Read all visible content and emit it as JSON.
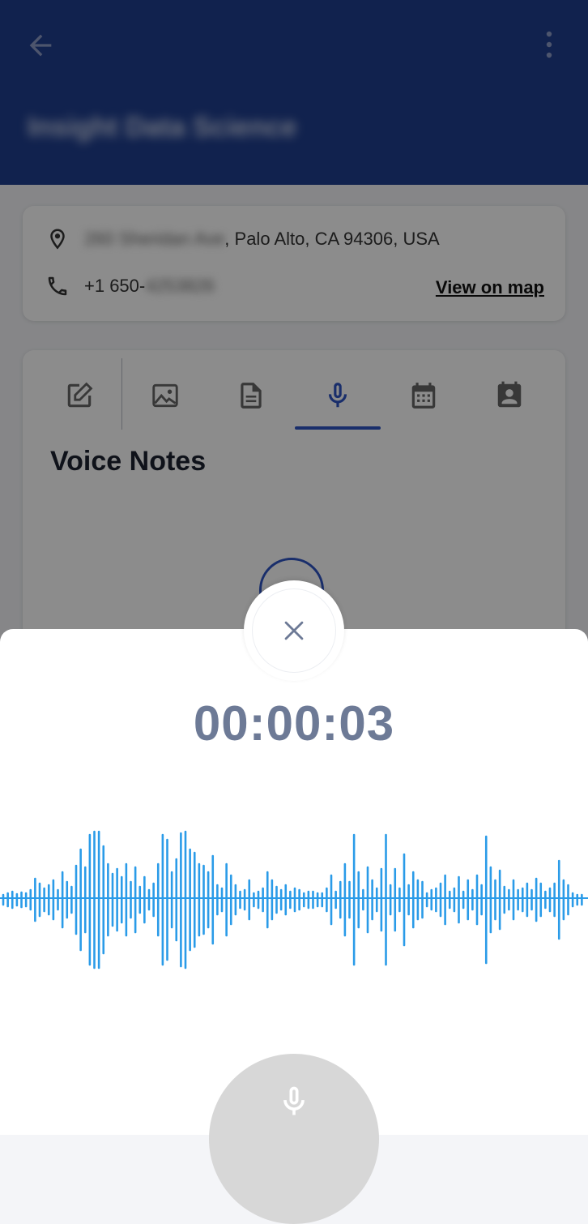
{
  "header": {
    "title": "Insight Data Science",
    "back_icon": "arrow-back-icon",
    "menu_icon": "more-vert-icon",
    "color": "#1f3e8e"
  },
  "info": {
    "address_prefix": "260 Sheridan Ave",
    "address_suffix": ", Palo Alto, CA 94306, USA",
    "phone_prefix": "+1 650-",
    "phone_hidden": "4253826",
    "view_on_map": "View on map"
  },
  "tabs": [
    {
      "icon": "edit-note-icon",
      "active": false
    },
    {
      "icon": "image-icon",
      "active": false
    },
    {
      "icon": "document-icon",
      "active": false
    },
    {
      "icon": "microphone-icon",
      "active": true
    },
    {
      "icon": "calendar-icon",
      "active": false
    },
    {
      "icon": "contact-icon",
      "active": false
    }
  ],
  "section": {
    "title": "Voice Notes"
  },
  "recorder": {
    "timer": "00:00:03",
    "close_icon": "close-icon",
    "mic_icon": "microphone-icon",
    "wave_color": "#2a9be8"
  }
}
